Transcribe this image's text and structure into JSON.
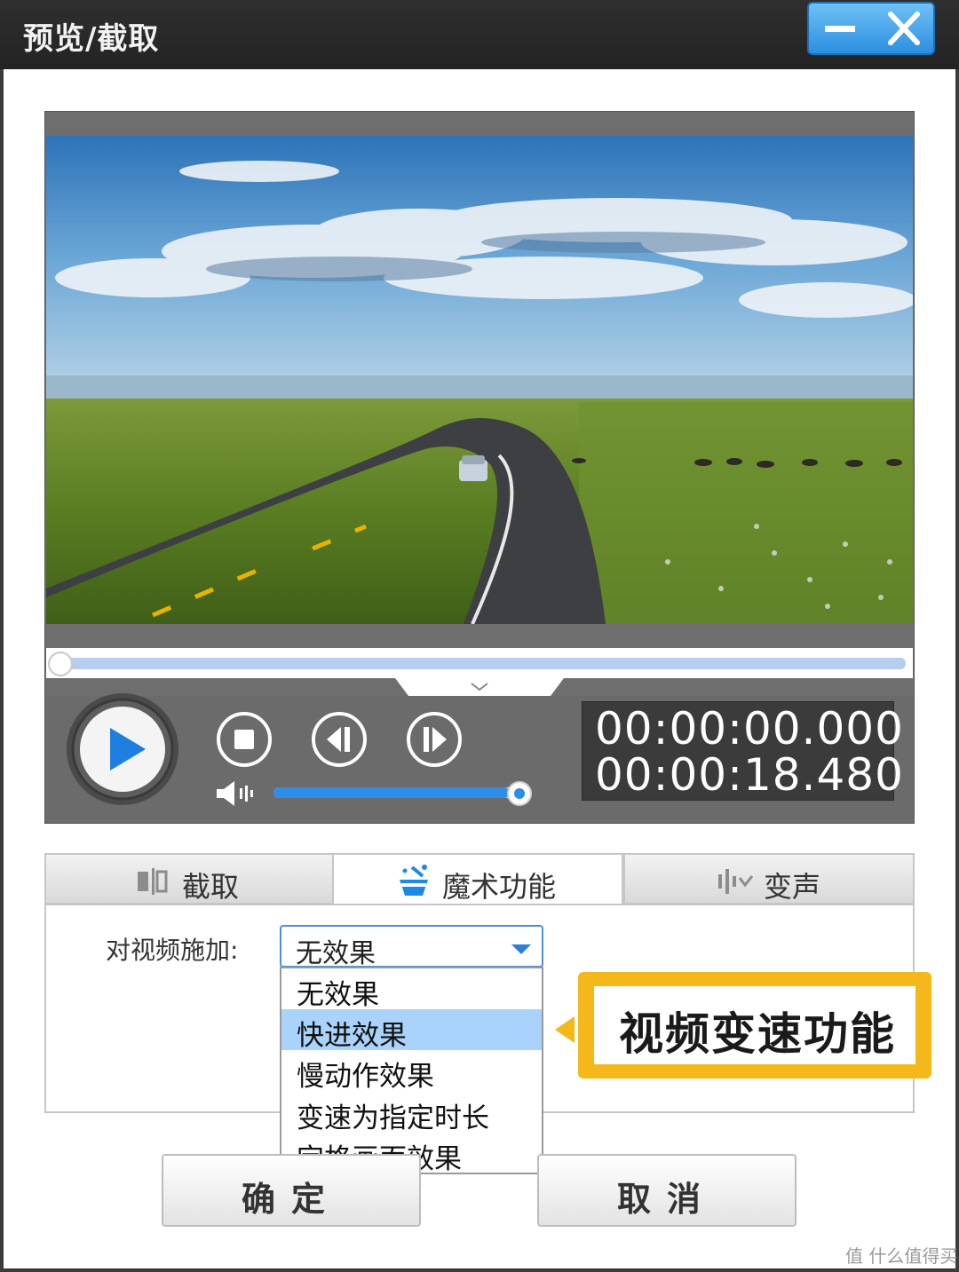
{
  "window": {
    "title": "预览/截取"
  },
  "player": {
    "current_time": "00:00:00.000",
    "total_time": "00:00:18.480",
    "seek_progress": 0.0,
    "volume_level": 0.95
  },
  "tabs": [
    {
      "label": "截取",
      "icon": "trim-icon",
      "active": false
    },
    {
      "label": "魔术功能",
      "icon": "magic-wand-icon",
      "active": true
    },
    {
      "label": "变声",
      "icon": "waveform-icon",
      "active": false
    }
  ],
  "effects": {
    "label": "对视频施加:",
    "selected": "无效果",
    "options": [
      "无效果",
      "快进效果",
      "慢动作效果",
      "变速为指定时长",
      "定格画面效果"
    ],
    "highlighted_index": 1
  },
  "callout": {
    "text": "视频变速功能",
    "color": "#f5b81b"
  },
  "buttons": {
    "ok": "确定",
    "cancel": "取消"
  },
  "watermark": "值 什么值得买",
  "colors": {
    "accent": "#2e8de6",
    "highlight": "#a9d3fa"
  }
}
